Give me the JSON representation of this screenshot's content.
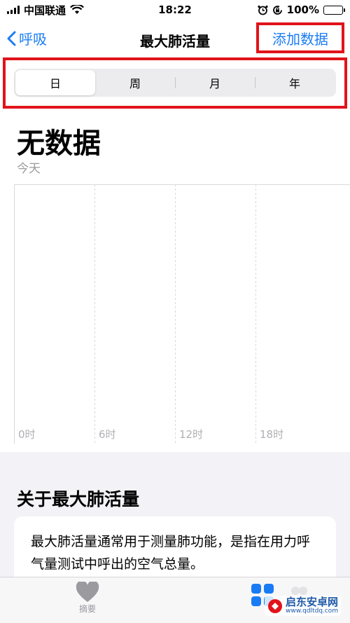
{
  "status_bar": {
    "carrier": "中国联通",
    "time": "18:22",
    "battery": "100%"
  },
  "nav": {
    "back_label": "呼吸",
    "title": "最大肺活量",
    "action_label": "添加数据"
  },
  "segments": {
    "items": [
      "日",
      "周",
      "月",
      "年"
    ],
    "selected": "日"
  },
  "summary": {
    "value": "无数据",
    "period": "今天"
  },
  "chart_data": {
    "type": "bar",
    "categories": [
      "0时",
      "6时",
      "12时",
      "18时"
    ],
    "series": [],
    "xlabel": "",
    "ylabel": "",
    "grid": true
  },
  "about": {
    "title": "关于最大肺活量",
    "text": "最大肺活量通常用于测量肺功能，是指在用力呼气量测试中呼出的空气总量。"
  },
  "tab_bar": {
    "summary_label": "摘要"
  },
  "watermark": {
    "name": "启东安卓网",
    "url": "www.qdltdq.com"
  },
  "colors": {
    "accent": "#1a7cf5",
    "highlight": "#e1141b",
    "battery": "#2fc04b"
  }
}
